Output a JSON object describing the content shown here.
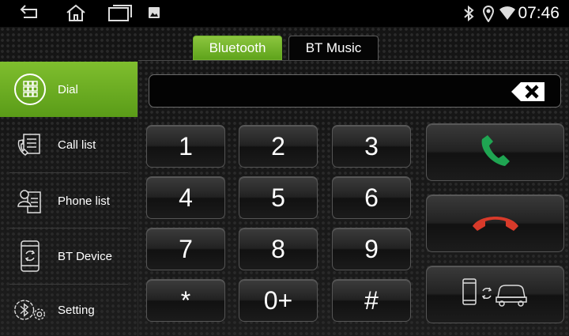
{
  "status_bar": {
    "time": "07:46",
    "icons": [
      "back-icon",
      "home-icon",
      "recent-apps-icon",
      "gallery-icon",
      "bluetooth-icon",
      "location-icon",
      "wifi-icon"
    ]
  },
  "tabs": [
    {
      "label": "Bluetooth",
      "active": true
    },
    {
      "label": "BT Music",
      "active": false
    }
  ],
  "sidebar": {
    "items": [
      {
        "label": "Dial",
        "icon": "dialpad-icon",
        "active": true
      },
      {
        "label": "Call list",
        "icon": "call-list-icon",
        "active": false
      },
      {
        "label": "Phone list",
        "icon": "contacts-icon",
        "active": false
      },
      {
        "label": "BT Device",
        "icon": "bt-device-icon",
        "active": false
      },
      {
        "label": "Setting",
        "icon": "settings-icon",
        "active": false
      }
    ]
  },
  "display": {
    "number": ""
  },
  "keypad": {
    "keys": [
      "1",
      "2",
      "3",
      "4",
      "5",
      "6",
      "7",
      "8",
      "9",
      "*",
      "0+",
      "#"
    ]
  },
  "actions": [
    "call-icon",
    "hangup-icon",
    "phone-car-transfer-icon"
  ],
  "colors": {
    "accent": "#6fb02a",
    "call": "#1fa552",
    "hangup": "#d83a2a"
  }
}
